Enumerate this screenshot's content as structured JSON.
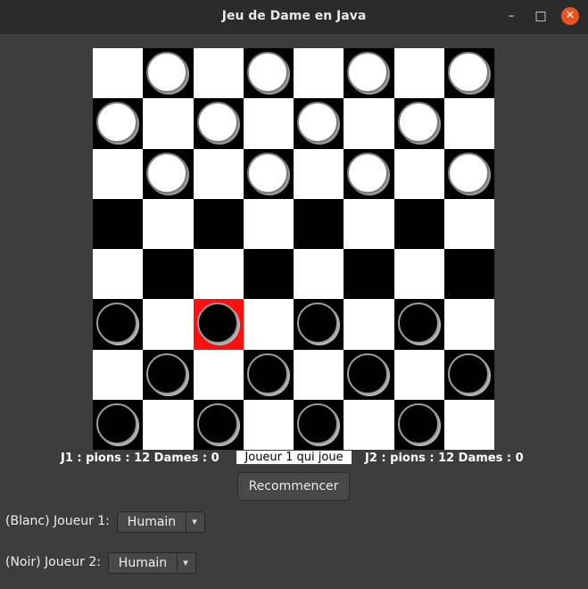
{
  "window": {
    "title": "Jeu de Dame en Java",
    "controls": {
      "minimize": "–",
      "maximize": "□",
      "close": "✕"
    }
  },
  "board": {
    "size": 8,
    "selected": [
      5,
      2
    ],
    "rows": [
      [
        "",
        "W",
        "",
        "W",
        "",
        "W",
        "",
        "W"
      ],
      [
        "W",
        "",
        "W",
        "",
        "W",
        "",
        "W",
        ""
      ],
      [
        "",
        "W",
        "",
        "W",
        "",
        "W",
        "",
        "W"
      ],
      [
        "",
        "",
        "",
        "",
        "",
        "",
        "",
        ""
      ],
      [
        "",
        "",
        "",
        "",
        "",
        "",
        "",
        ""
      ],
      [
        "B",
        "",
        "B",
        "",
        "B",
        "",
        "B",
        ""
      ],
      [
        "",
        "B",
        "",
        "B",
        "",
        "B",
        "",
        "B"
      ],
      [
        "B",
        "",
        "B",
        "",
        "B",
        "",
        "B",
        ""
      ]
    ]
  },
  "status": {
    "j1": "J1 : pions : 12 Dames : 0",
    "turn": "Joueur 1 qui joue",
    "j2": "J2 : pions : 12 Dames : 0"
  },
  "controls": {
    "restart": "Recommencer",
    "player1_label": "(Blanc) Joueur 1:",
    "player1_value": "Humain",
    "player2_label": "(Noir) Joueur 2:",
    "player2_value": "Humain",
    "dropdown_icon": "chevron-down-icon"
  },
  "colors": {
    "background": "#3d3d3d",
    "light_square": "#ffffff",
    "dark_square": "#000000",
    "selected_square": "#ff1010",
    "close_button": "#e95420"
  }
}
